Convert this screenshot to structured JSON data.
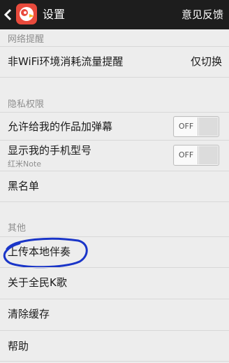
{
  "header": {
    "title": "设置",
    "feedback": "意见反馈"
  },
  "network": {
    "section": "网络提醒",
    "wifi_label": "非WiFi环境消耗流量提醒",
    "wifi_value": "仅切换"
  },
  "privacy": {
    "section": "隐私权限",
    "danmu_label": "允许给我的作品加弹幕",
    "danmu_state": "OFF",
    "model_label": "显示我的手机型号",
    "model_sub": "红米Note",
    "model_state": "OFF",
    "blacklist_label": "黑名单"
  },
  "other": {
    "section": "其他",
    "upload_label": "上传本地伴奏",
    "about_label": "关于全民K歌",
    "clear_cache_label": "清除缓存",
    "help_label": "帮助"
  },
  "colors": {
    "titlebar": "#1d1d1d",
    "background": "#ededed",
    "annotation": "#1a35c8"
  }
}
